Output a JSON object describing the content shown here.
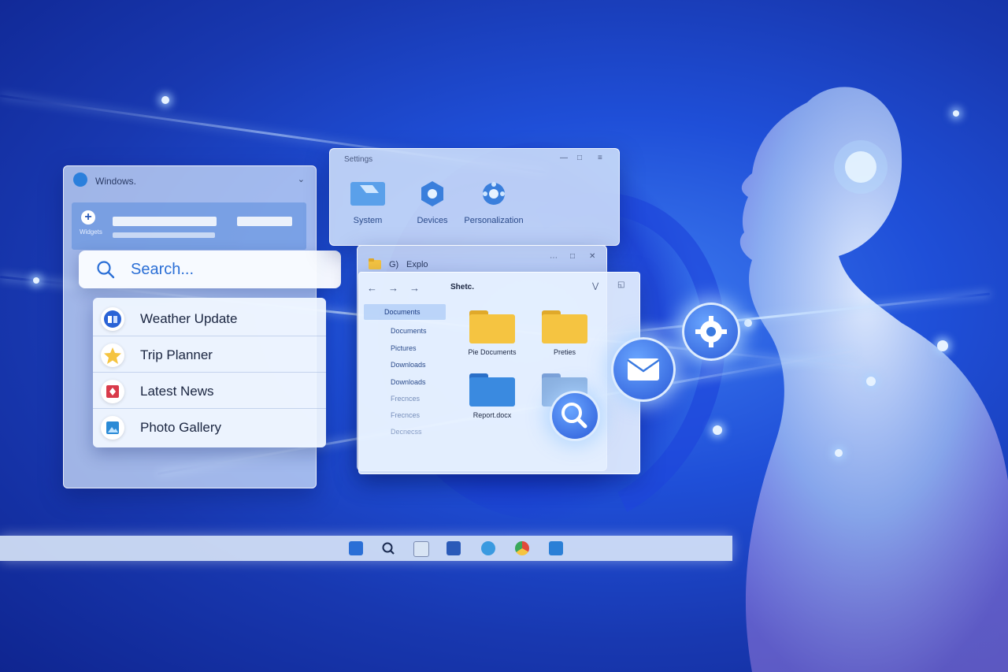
{
  "windows_panel": {
    "title": "Windows.",
    "sub_label": "Widgets"
  },
  "search": {
    "placeholder": "Search..."
  },
  "search_results": [
    {
      "label": "Weather Update",
      "icon": "weather-icon"
    },
    {
      "label": "Trip Planner",
      "icon": "star-icon"
    },
    {
      "label": "Latest News",
      "icon": "news-icon"
    },
    {
      "label": "Photo Gallery",
      "icon": "photo-icon"
    }
  ],
  "settings": {
    "title": "Settings",
    "items": [
      {
        "label": "System",
        "icon": "system-icon"
      },
      {
        "label": "Devices",
        "icon": "devices-icon"
      },
      {
        "label": "Personalization",
        "icon": "personalization-icon"
      }
    ]
  },
  "explorer": {
    "title": "Explo",
    "title_prefix": "G)",
    "path": "Shetc.",
    "sidebar": [
      "Documents",
      "Documents",
      "Pictures",
      "Downloads",
      "Downloads",
      "Frecnces",
      "Frecnces",
      "Decnecss"
    ],
    "files": [
      {
        "label": "Pie Documents",
        "color": "#f5c441"
      },
      {
        "label": "Preties",
        "color": "#f5c441"
      },
      {
        "label": "Report.docx",
        "color": "#3a8ae0"
      },
      {
        "label": "",
        "color": "#8ab0e0"
      }
    ]
  },
  "floating_icons": [
    "search-icon",
    "mail-icon",
    "gear-icon"
  ],
  "taskbar": [
    "start-icon",
    "search-icon",
    "widgets-icon",
    "file-explorer-icon",
    "edge-icon",
    "chrome-icon",
    "store-icon"
  ],
  "colors": {
    "accent": "#2b6fd6",
    "background": "#1f4fd8",
    "folder_yellow": "#f5c441"
  }
}
